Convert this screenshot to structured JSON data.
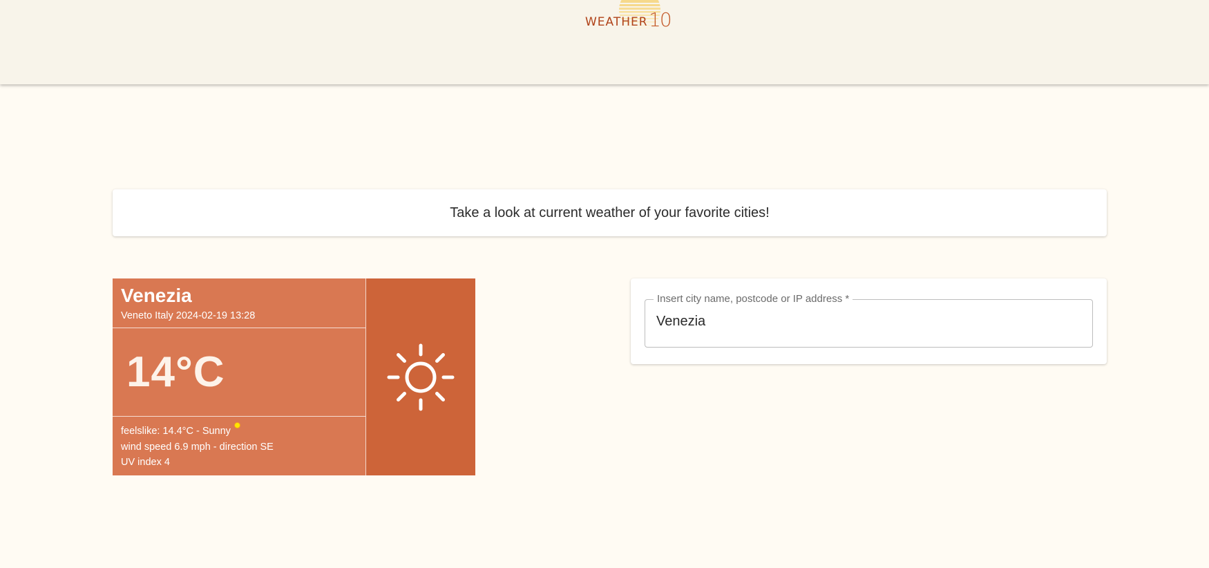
{
  "header": {
    "logo_text": "WEATHER",
    "logo_number": "10"
  },
  "banner": {
    "text": "Take a look at current weather of your favorite cities!"
  },
  "weather_card": {
    "city": "Venezia",
    "region_line": "Veneto Italy 2024-02-19 13:28",
    "temperature": "14°C",
    "feelslike": "feelslike: 14.4°C - Sunny",
    "wind": "wind speed 6.9 mph - direction SE",
    "uv": "UV index 4",
    "condition_icon": "sun-icon",
    "colors": {
      "panel": "#d97852",
      "icon_panel": "#cd6439"
    }
  },
  "search": {
    "label": "Insert city name, postcode or IP address *",
    "value": "Venezia"
  }
}
